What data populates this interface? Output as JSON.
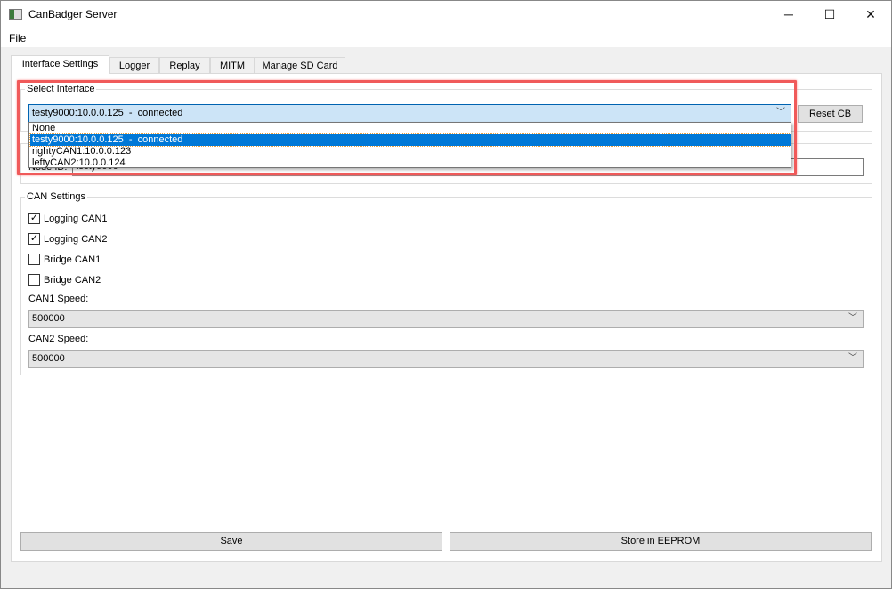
{
  "window": {
    "title": "CanBadger Server",
    "minimize": "─",
    "maximize": "☐",
    "close": "✕"
  },
  "menu": {
    "file": "File"
  },
  "tabs": [
    {
      "label": "Interface Settings",
      "active": true
    },
    {
      "label": "Logger"
    },
    {
      "label": "Replay"
    },
    {
      "label": "MITM"
    },
    {
      "label": "Manage SD Card"
    }
  ],
  "select_interface": {
    "title": "Select Interface",
    "selected": "testy9000:10.0.0.125  -  connected",
    "options": [
      "None",
      "testy9000:10.0.0.125  -  connected",
      "rightyCAN1:10.0.0.123",
      "leftyCAN2:10.0.0.124"
    ],
    "reset_label": "Reset CB"
  },
  "node": {
    "label": "Node ID:",
    "value": "testy9000"
  },
  "can_settings": {
    "title": "CAN Settings",
    "checkboxes": [
      {
        "label": "Logging CAN1",
        "checked": true
      },
      {
        "label": "Logging CAN2",
        "checked": true
      },
      {
        "label": "Bridge CAN1",
        "checked": false
      },
      {
        "label": "Bridge CAN2",
        "checked": false
      }
    ],
    "can1_label": "CAN1 Speed:",
    "can1_value": "500000",
    "can2_label": "CAN2 Speed:",
    "can2_value": "500000"
  },
  "buttons": {
    "save": "Save",
    "store": "Store in EEPROM"
  },
  "colors": {
    "highlight": "#f05a5a",
    "selection": "#0078d7"
  }
}
